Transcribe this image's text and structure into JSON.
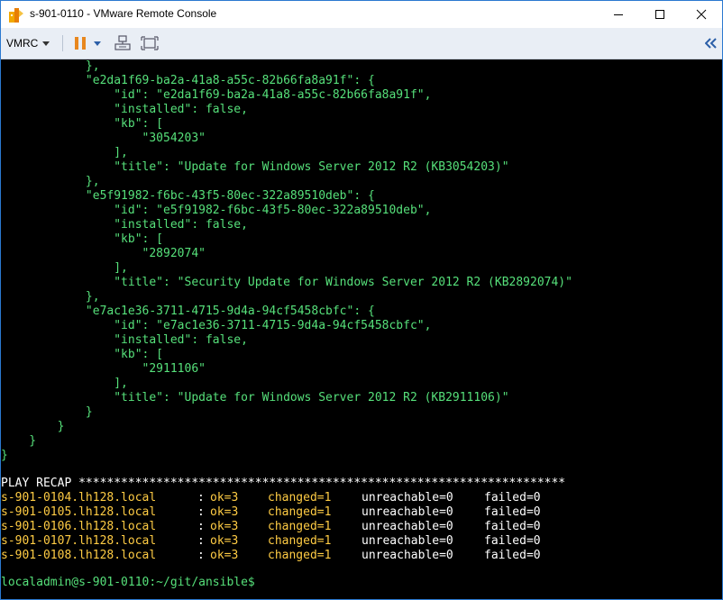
{
  "window": {
    "title": "s-901-0110 - VMware Remote Console",
    "accent": "#2b79d0"
  },
  "toolbar": {
    "menu_label": "VMRC",
    "icons": [
      "pause-icon",
      "dropdown-icon",
      "send-ctrl-alt-del-icon",
      "fit-guest-icon",
      "collapse-icon"
    ]
  },
  "terminal": {
    "colors": {
      "background": "#000000",
      "json": "#56e07a",
      "host": "#ffcc44",
      "default": "#ffffff"
    },
    "json_lines": [
      "            },",
      "            \"e2da1f69-ba2a-41a8-a55c-82b66fa8a91f\": {",
      "                \"id\": \"e2da1f69-ba2a-41a8-a55c-82b66fa8a91f\",",
      "                \"installed\": false,",
      "                \"kb\": [",
      "                    \"3054203\"",
      "                ],",
      "                \"title\": \"Update for Windows Server 2012 R2 (KB3054203)\"",
      "            },",
      "            \"e5f91982-f6bc-43f5-80ec-322a89510deb\": {",
      "                \"id\": \"e5f91982-f6bc-43f5-80ec-322a89510deb\",",
      "                \"installed\": false,",
      "                \"kb\": [",
      "                    \"2892074\"",
      "                ],",
      "                \"title\": \"Security Update for Windows Server 2012 R2 (KB2892074)\"",
      "            },",
      "            \"e7ac1e36-3711-4715-9d4a-94cf5458cbfc\": {",
      "                \"id\": \"e7ac1e36-3711-4715-9d4a-94cf5458cbfc\",",
      "                \"installed\": false,",
      "                \"kb\": [",
      "                    \"2911106\"",
      "                ],",
      "                \"title\": \"Update for Windows Server 2012 R2 (KB2911106)\"",
      "            }",
      "        }",
      "    }",
      "}"
    ],
    "recap_header": "PLAY RECAP *********************************************************************",
    "recap_rows": [
      {
        "host": "s-901-0104.lh128.local",
        "sep": ":",
        "ok": "ok=3",
        "changed": "changed=1",
        "unreachable": "unreachable=0",
        "failed": "failed=0"
      },
      {
        "host": "s-901-0105.lh128.local",
        "sep": ":",
        "ok": "ok=3",
        "changed": "changed=1",
        "unreachable": "unreachable=0",
        "failed": "failed=0"
      },
      {
        "host": "s-901-0106.lh128.local",
        "sep": ":",
        "ok": "ok=3",
        "changed": "changed=1",
        "unreachable": "unreachable=0",
        "failed": "failed=0"
      },
      {
        "host": "s-901-0107.lh128.local",
        "sep": ":",
        "ok": "ok=3",
        "changed": "changed=1",
        "unreachable": "unreachable=0",
        "failed": "failed=0"
      },
      {
        "host": "s-901-0108.lh128.local",
        "sep": ":",
        "ok": "ok=3",
        "changed": "changed=1",
        "unreachable": "unreachable=0",
        "failed": "failed=0"
      }
    ],
    "prompt": "localadmin@s-901-0110:~/git/ansible$"
  }
}
